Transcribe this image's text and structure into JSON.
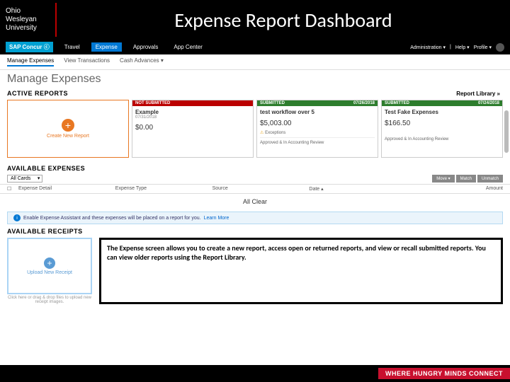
{
  "slide": {
    "university": "Ohio Wesleyan University",
    "title": "Expense Report Dashboard",
    "footer_tag": "WHERE HUNGRY MINDS CONNECT"
  },
  "topbar": {
    "brand": "SAP Concur ⓒ",
    "nav": {
      "travel": "Travel",
      "expense": "Expense",
      "approvals": "Approvals",
      "appcenter": "App Center"
    },
    "admin": "Administration ▾",
    "help": "Help ▾",
    "profile": "Profile ▾"
  },
  "subnav": {
    "manage": "Manage Expenses",
    "view": "View Transactions",
    "cash": "Cash Advances ▾"
  },
  "page": {
    "title": "Manage Expenses"
  },
  "sections": {
    "active": "ACTIVE REPORTS",
    "available_exp": "AVAILABLE EXPENSES",
    "available_rec": "AVAILABLE RECEIPTS",
    "report_library": "Report Library »"
  },
  "create": {
    "label": "Create New Report"
  },
  "cards": {
    "c1": {
      "status": "NOT SUBMITTED",
      "date_hdr": "",
      "name": "Example",
      "date": "07/31/2018",
      "amount": "$0.00",
      "note": ""
    },
    "c2": {
      "status": "SUBMITTED",
      "date_hdr": "07/26/2018",
      "name": "test workflow over 5",
      "date": "",
      "amount": "$5,003.00",
      "exceptions": "Exceptions",
      "note": "Approved & In Accounting Review"
    },
    "c3": {
      "status": "SUBMITTED",
      "date_hdr": "07/24/2018",
      "name": "Test Fake Expenses",
      "date": "",
      "amount": "$166.50",
      "note": "Approved & In Accounting Review"
    }
  },
  "toolbar": {
    "filter": "All Cards",
    "btn_move": "Move ▾",
    "btn_match": "Match",
    "btn_unmatch": "Unmatch"
  },
  "table": {
    "h1": "Expense Detail",
    "h2": "Expense Type",
    "h3": "Source",
    "h4": "Date ▴",
    "h5": "Amount",
    "empty": "All Clear"
  },
  "banner": {
    "text": "Enable Expense Assistant and these expenses will be placed on a report for you.",
    "link": "Learn More"
  },
  "upload": {
    "label": "Upload New Receipt",
    "hint": "Click here or drag & drop files to upload new receipt images."
  },
  "callout": {
    "text": "The Expense screen allows you to create a new report, access open or returned reports, and view or recall submitted reports. You can view older reports using the Report Library."
  }
}
